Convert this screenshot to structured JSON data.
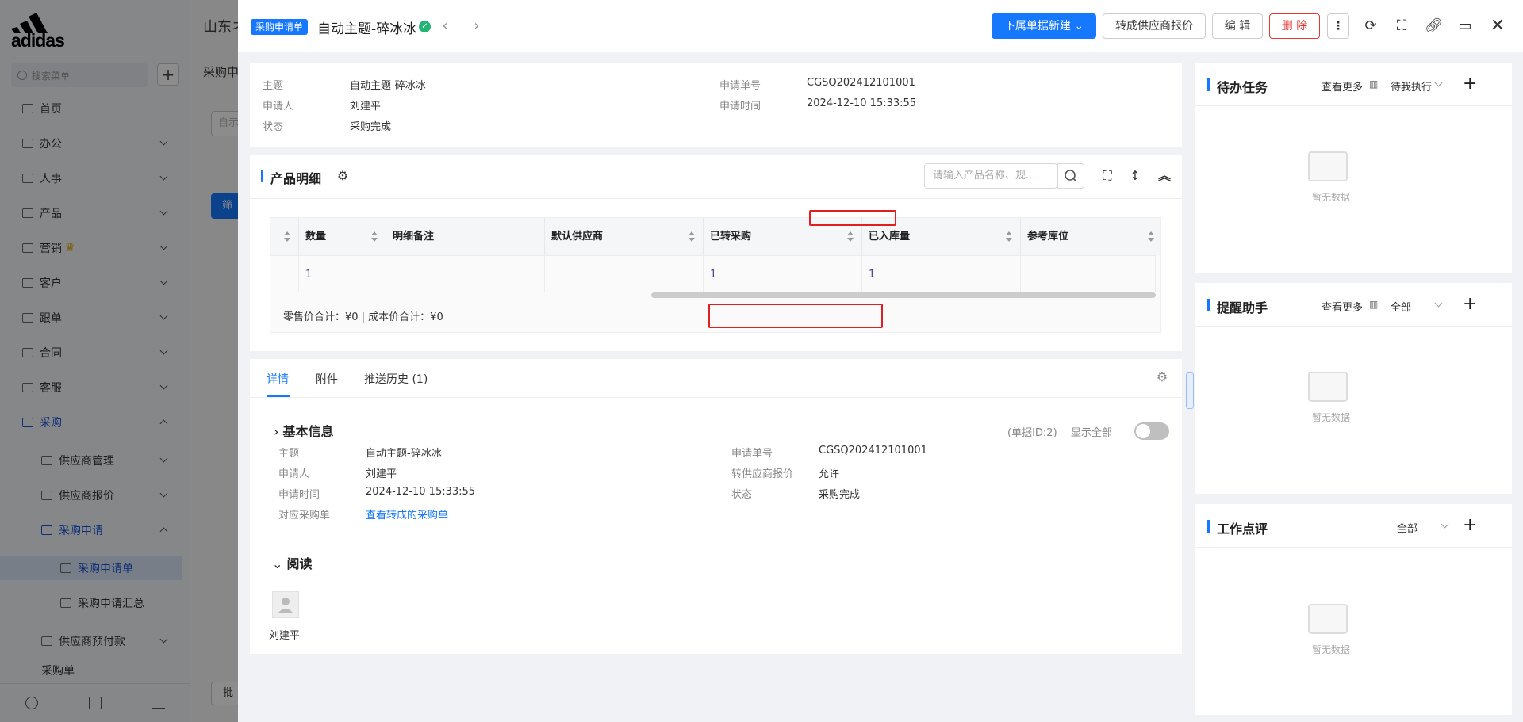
{
  "sidebar": {
    "brand": "adidas",
    "search_placeholder": "搜索菜单",
    "items": [
      {
        "label": "首页"
      },
      {
        "label": "办公"
      },
      {
        "label": "人事"
      },
      {
        "label": "产品"
      },
      {
        "label": "营销"
      },
      {
        "label": "客户"
      },
      {
        "label": "跟单"
      },
      {
        "label": "合同"
      },
      {
        "label": "客服"
      },
      {
        "label": "采购"
      }
    ],
    "sub_items": [
      {
        "label": "供应商管理"
      },
      {
        "label": "供应商报价"
      },
      {
        "label": "采购申请"
      }
    ],
    "sub2_items": [
      {
        "label": "采购申请单"
      },
      {
        "label": "采购申请汇总"
      }
    ],
    "more_item": "供应商预付款",
    "cut_item": "采购单"
  },
  "background_page": {
    "company": "山东ネ",
    "page_title": "采购申",
    "filter_btn": "筛",
    "input_hint": "自示",
    "bottom_btn": "批"
  },
  "header": {
    "tag": "采购申请单",
    "title": "自动主题-碎冰冰",
    "status_icon": "check-circle",
    "buttons": {
      "new_sub": "下属单据新建",
      "convert_quote": "转成供应商报价",
      "edit": "编 辑",
      "delete": "删 除"
    }
  },
  "summary": {
    "subject_label": "主题",
    "subject": "自动主题-碎冰冰",
    "applicant_label": "申请人",
    "applicant": "刘建平",
    "status_label": "状态",
    "status": "采购完成",
    "number_label": "申请单号",
    "number": "CGSQ202412101001",
    "time_label": "申请时间",
    "time": "2024-12-10 15:33:55"
  },
  "products": {
    "title": "产品明细",
    "search_placeholder": "请输入产品名称、规...",
    "columns": [
      "数量",
      "明细备注",
      "默认供应商",
      "已转采购",
      "已入库量",
      "参考库位"
    ],
    "rows": [
      [
        "1",
        "",
        "",
        "1",
        "1",
        ""
      ]
    ],
    "footer": "零售价合计：¥0 |   成本价合计：¥0"
  },
  "detail_tabs": [
    {
      "label": "详情",
      "active": true
    },
    {
      "label": "附件",
      "active": false
    },
    {
      "label": "推送历史 (1)",
      "active": false
    }
  ],
  "basic": {
    "title": "基本信息",
    "doc_id": "(单据ID:2)",
    "show_all": "显示全部",
    "fields_left": [
      {
        "label": "主题",
        "value": "自动主题-碎冰冰"
      },
      {
        "label": "申请人",
        "value": "刘建平"
      },
      {
        "label": "申请时间",
        "value": "2024-12-10 15:33:55"
      },
      {
        "label": "对应采购单",
        "value": "查看转成的采购单"
      }
    ],
    "fields_right": [
      {
        "label": "申请单号",
        "value": "CGSQ202412101001"
      },
      {
        "label": "转供应商报价",
        "value": "允许"
      },
      {
        "label": "状态",
        "value": "采购完成"
      }
    ]
  },
  "reading": {
    "title": "阅读",
    "reader": "刘建平"
  },
  "right": {
    "todo": {
      "title": "待办任务",
      "more": "查看更多",
      "filter": "待我执行",
      "empty": "暂无数据"
    },
    "reminder": {
      "title": "提醒助手",
      "more": "查看更多",
      "filter": "全部",
      "empty": "暂无数据"
    },
    "review": {
      "title": "工作点评",
      "filter": "全部",
      "empty": "暂无数据"
    }
  }
}
